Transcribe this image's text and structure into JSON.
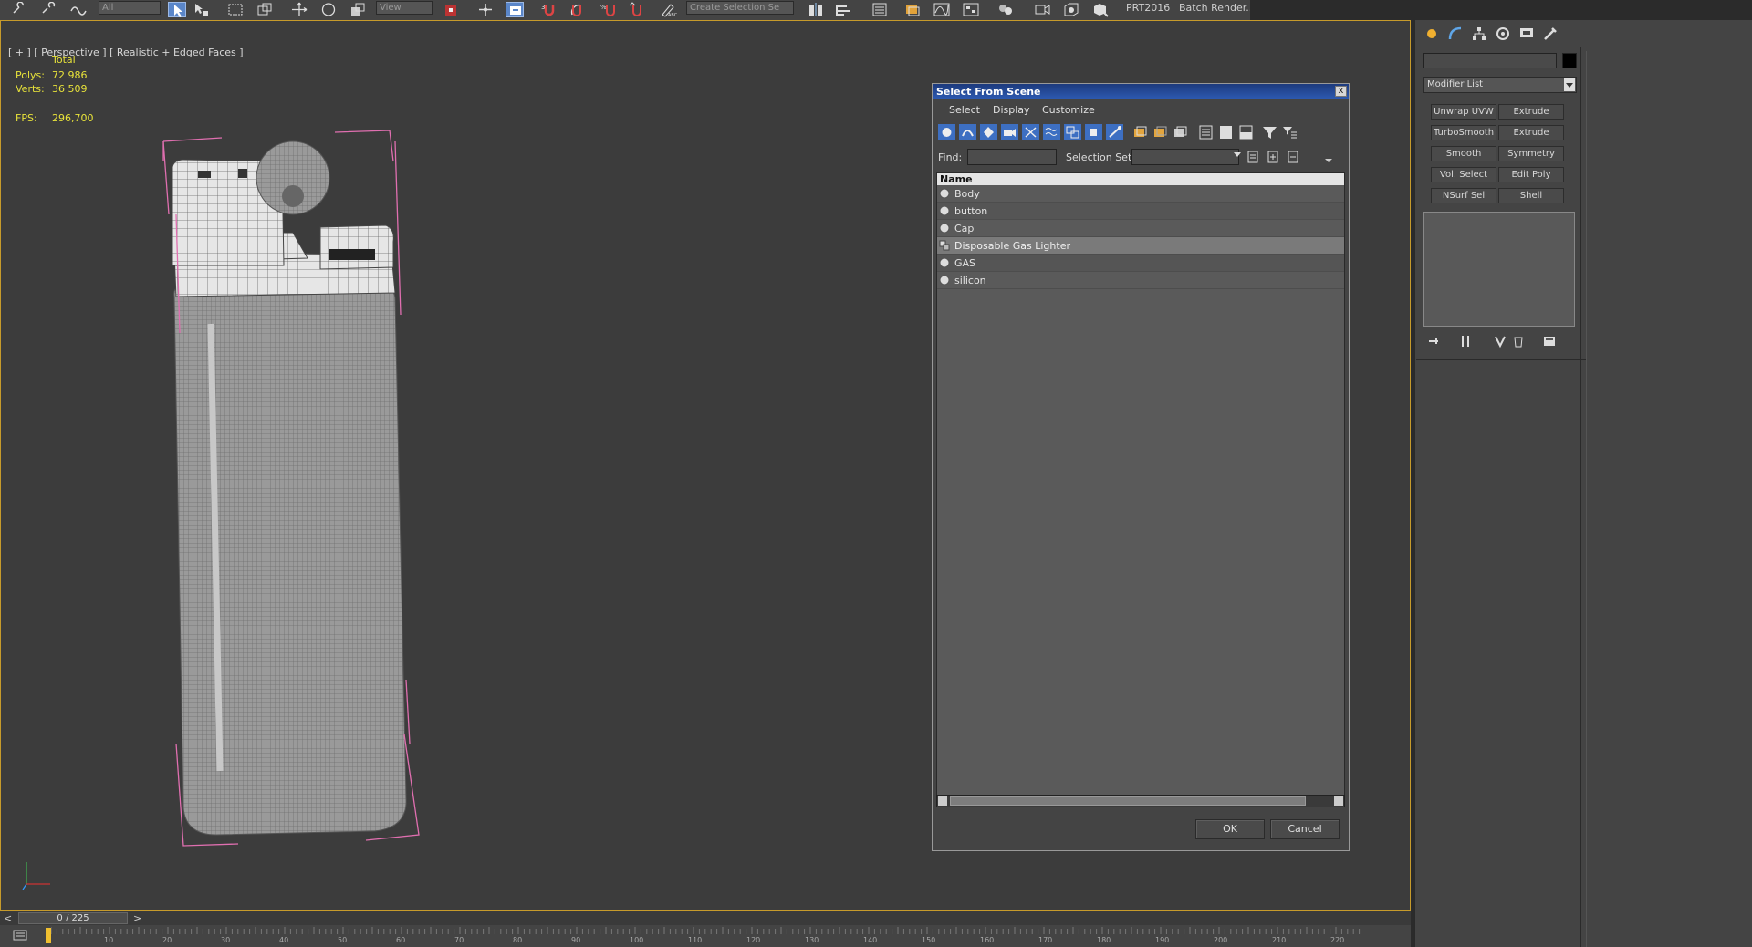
{
  "toolbar": {
    "selection_filter": "All",
    "view_dropdown": "View",
    "selection_set_dropdown": "Create Selection Se",
    "prt_label": "PRT2016",
    "batch_render_label": "Batch Render..."
  },
  "viewport": {
    "label": "[ + ] [ Perspective ] [ Realistic + Edged Faces ]",
    "stats": {
      "total_label": "Total",
      "polys_label": "Polys:",
      "polys_value": "72 986",
      "verts_label": "Verts:",
      "verts_value": "36 509",
      "fps_label": "FPS:",
      "fps_value": "296,700"
    }
  },
  "dialog": {
    "title": "Select From Scene",
    "close_glyph": "x",
    "menu": [
      "Select",
      "Display",
      "Customize"
    ],
    "find_label": "Find:",
    "find_value": "",
    "selection_set_label": "Selection Set:",
    "selection_set_value": "",
    "column_header": "Name",
    "objects": [
      {
        "name": "Body",
        "icon": "geometry-icon"
      },
      {
        "name": "button",
        "icon": "geometry-icon"
      },
      {
        "name": "Cap",
        "icon": "geometry-icon"
      },
      {
        "name": "Disposable Gas Lighter",
        "icon": "group-icon",
        "selected": true
      },
      {
        "name": "GAS",
        "icon": "geometry-icon"
      },
      {
        "name": "silicon",
        "icon": "geometry-icon"
      }
    ],
    "ok_label": "OK",
    "cancel_label": "Cancel"
  },
  "command_panel": {
    "modifier_list_label": "Modifier List",
    "name_field_value": "",
    "modifier_buttons": [
      [
        "Unwrap UVW",
        "Extrude"
      ],
      [
        "TurboSmooth",
        "Extrude"
      ],
      [
        "Smooth",
        "Symmetry"
      ],
      [
        "Vol. Select",
        "Edit Poly"
      ],
      [
        "NSurf Sel",
        "Shell"
      ]
    ],
    "tabs": [
      "create-icon",
      "modify-icon",
      "hierarchy-icon",
      "motion-icon",
      "display-icon",
      "utilities-icon"
    ]
  },
  "timeline": {
    "frame_counter": "0 / 225",
    "prev_glyph": "<",
    "next_glyph": ">",
    "ticks": [
      "10",
      "20",
      "30",
      "40",
      "50",
      "60",
      "70",
      "80",
      "90",
      "100",
      "110",
      "120",
      "130",
      "140",
      "150",
      "160",
      "170",
      "180",
      "190",
      "200",
      "210",
      "220"
    ]
  },
  "colors": {
    "viewport_border": "#c79b2b",
    "stats_text": "#e8e33a",
    "title_bar": "#2d5bb3",
    "bounding_box": "#e06fb0"
  }
}
